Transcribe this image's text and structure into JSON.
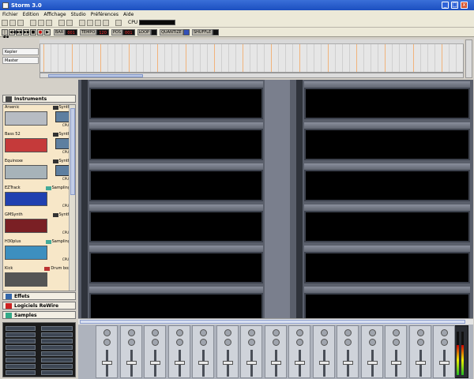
{
  "window": {
    "title": "Storm 3.0",
    "minimize": "_",
    "maximize": "□",
    "close": "x"
  },
  "menu": [
    "Fichier",
    "Edition",
    "Affichage",
    "Studio",
    "Préférences",
    "Aide"
  ],
  "toolbar": {
    "cpu_label": "CPU"
  },
  "transport": {
    "buttons": [
      "|◀◀",
      "◀◀",
      "▶▶",
      "▶▶|",
      "■",
      "●",
      "▶"
    ],
    "boxes": [
      {
        "label": "BAR",
        "value": "001"
      },
      {
        "label": "TEMPO",
        "value": "120"
      },
      {
        "label": "POS",
        "value": "001"
      },
      {
        "label": "LOOP",
        "value": ""
      },
      {
        "label": "QUANTIZE",
        "value": ""
      },
      {
        "label": "SHUFFLE",
        "value": ""
      }
    ]
  },
  "tracks": [
    "Kepler",
    "Master"
  ],
  "categories": {
    "instruments": "Instruments",
    "effects": "Effets",
    "rewire": "Logiciels ReWire",
    "samples": "Samples"
  },
  "instruments": [
    {
      "name": "Arsenic",
      "type": "Synth",
      "cpu": "CPU"
    },
    {
      "name": "Bass 52",
      "type": "Synth",
      "cpu": "CPU"
    },
    {
      "name": "Equinoxe",
      "type": "Synth",
      "cpu": "CPU"
    },
    {
      "name": "EZTrack",
      "type": "Sampling",
      "cpu": "CPU"
    },
    {
      "name": "GMSynth",
      "type": "Synth",
      "cpu": "CPU"
    },
    {
      "name": "H30plus",
      "type": "Sampling",
      "cpu": "CPU"
    },
    {
      "name": "Kick",
      "type": "Drum box",
      "cpu": ""
    }
  ],
  "colors": {
    "accent": "#1b4fc0",
    "panel": "#f7e7c8",
    "rack": "#5a5f6b"
  }
}
